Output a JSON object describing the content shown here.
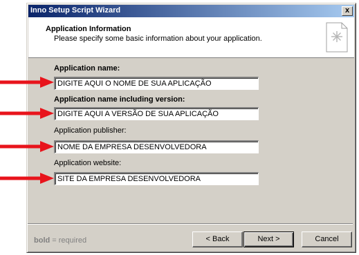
{
  "window": {
    "title": "Inno Setup Script Wizard",
    "close_label": "x"
  },
  "header": {
    "title": "Application Information",
    "subtitle": "Please specify some basic information about your application.",
    "icon": "document-star-icon"
  },
  "form": {
    "name_label": "Application name:",
    "name_value": "DIGITE AQUI O NOME DE SUA APLICAÇÃO",
    "version_label": "Application name including version:",
    "version_value": "DIGITE AQUI A VERSÃO DE SUA APLICAÇÃO",
    "publisher_label": "Application publisher:",
    "publisher_value": "NOME DA EMPRESA DESENVOLVEDORA",
    "website_label": "Application website:",
    "website_value": "SITE DA EMPRESA DESENVOLVEDORA"
  },
  "footer": {
    "required_bold": "bold",
    "required_rest": " = required",
    "back_label": "< Back",
    "next_label": "Next >",
    "cancel_label": "Cancel"
  },
  "colors": {
    "arrow": "#e8141c",
    "titlebar_start": "#0a246a",
    "titlebar_end": "#a6caf0",
    "dialog_face": "#d4d0c8"
  }
}
